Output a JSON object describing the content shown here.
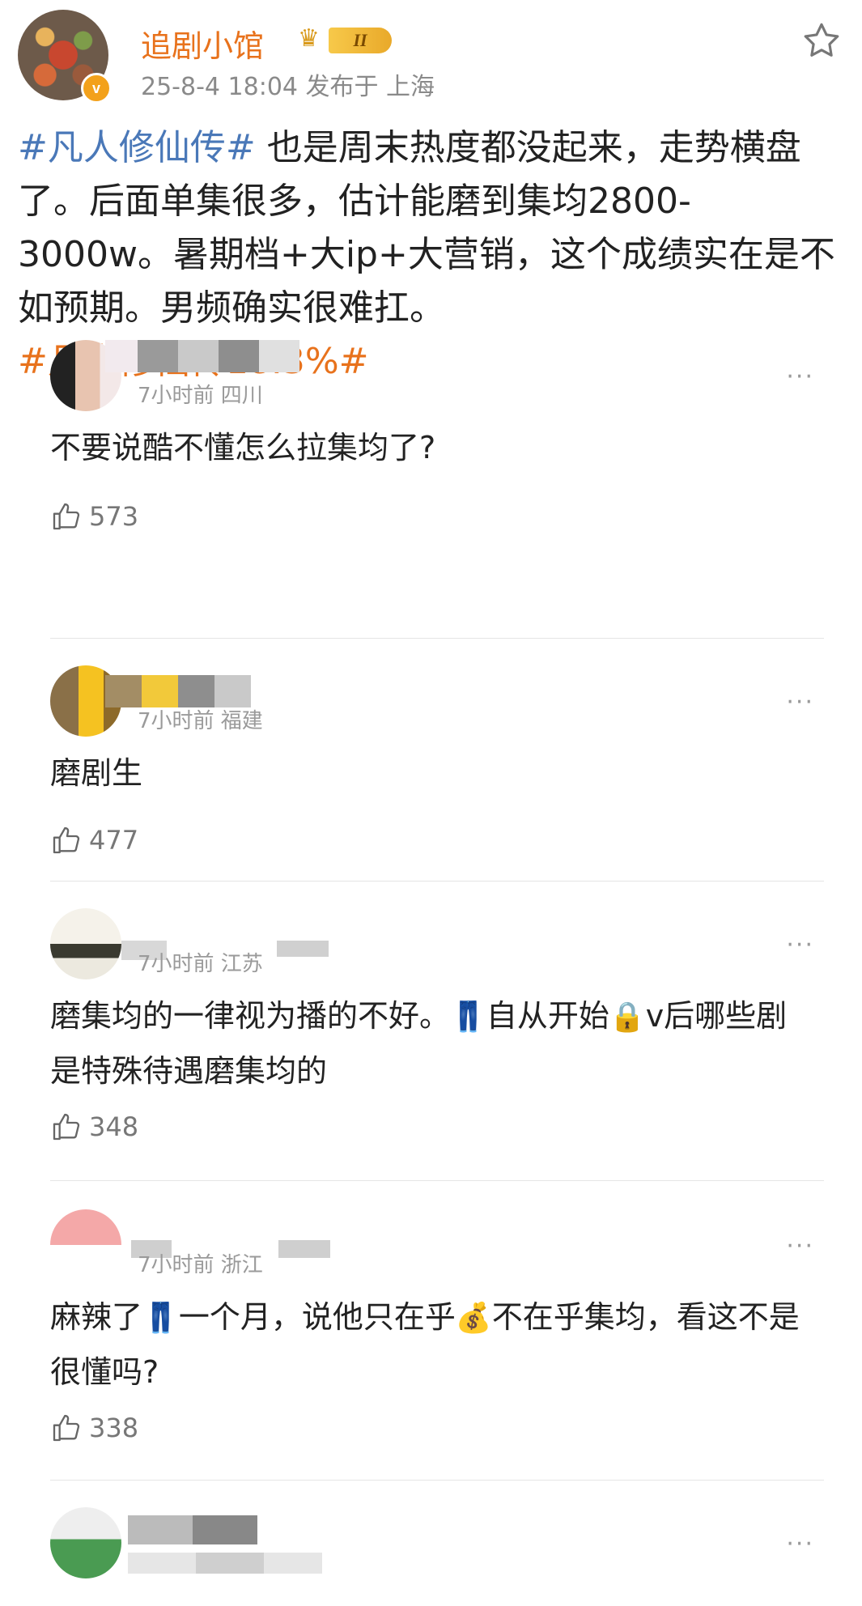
{
  "post": {
    "author": "追剧小馆",
    "level": "II",
    "meta": "25-8-4 18:04  发布于 上海",
    "tag1": "#凡人修仙传#",
    "body": " 也是周末热度都没起来，走势横盘了。后面单集很多，估计能磨到集均2800-3000w。暑期档+大ip+大营销，这个成绩实在是不如预期。男频确实很难扛。",
    "tag2": "#凡人修仙传18.3%#"
  },
  "comments": [
    {
      "meta": "7小时前 四川",
      "text": "不要说酷不懂怎么拉集均了?",
      "likes": "573"
    },
    {
      "meta": "7小时前 福建",
      "text": "磨剧生",
      "likes": "477"
    },
    {
      "meta": "7小时前 江苏",
      "text_a": "磨集均的一律视为播的不好。",
      "text_b": "自从开始",
      "text_c": "v后哪些剧是特殊待遇磨集均的",
      "likes": "348"
    },
    {
      "meta": "7小时前 浙江",
      "text_a": "麻辣了",
      "text_b": "一个月，说他只在乎",
      "text_c": "不在乎集均，看这不是很懂吗?",
      "likes": "338"
    },
    {
      "meta": "",
      "text": "",
      "likes": ""
    }
  ],
  "icons": {
    "more": "···",
    "jeans": "👖",
    "lock": "🔒",
    "money": "💰",
    "crown": "♛"
  },
  "colors": {
    "accent_orange": "#e8721c",
    "tag_blue": "#4a78b8",
    "meta_gray": "#8a8a8a"
  }
}
